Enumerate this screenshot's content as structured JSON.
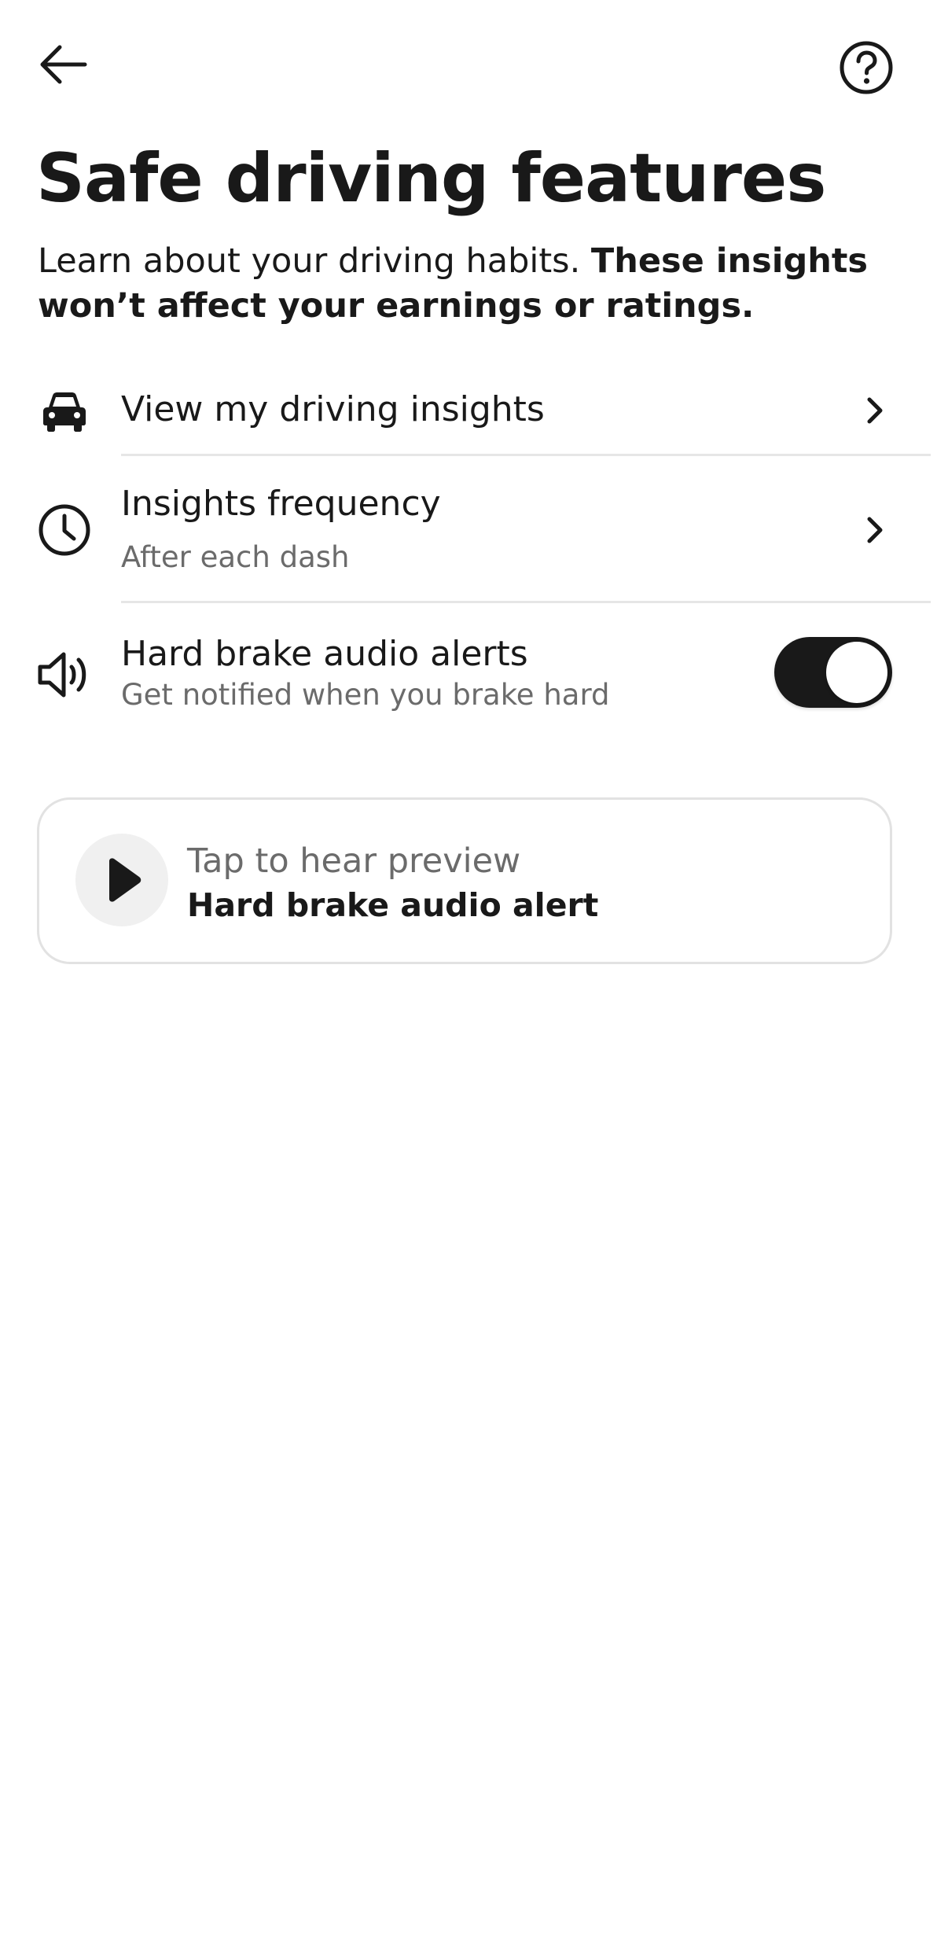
{
  "header": {
    "back_icon": "arrow-left-icon",
    "help_icon": "question-circle-icon"
  },
  "page": {
    "title": "Safe driving features",
    "subtitle_regular": "Learn about your driving habits. ",
    "subtitle_bold": "These insights won’t affect your earnings or ratings."
  },
  "rows": [
    {
      "icon": "car-icon",
      "title": "View my driving insights"
    },
    {
      "icon": "clock-icon",
      "title": "Insights frequency",
      "subtitle": "After each dash"
    },
    {
      "icon": "speaker-icon",
      "title": "Hard brake audio alerts",
      "subtitle": "Get notified when you brake hard",
      "toggle_on": true
    }
  ],
  "preview": {
    "icon": "play-icon",
    "line1": "Tap to hear preview",
    "line2": "Hard brake audio alert"
  },
  "colors": {
    "text_primary": "#191919",
    "text_secondary": "#6b6b6b",
    "toggle_on": "#191919",
    "divider": "#e6e6e6"
  }
}
